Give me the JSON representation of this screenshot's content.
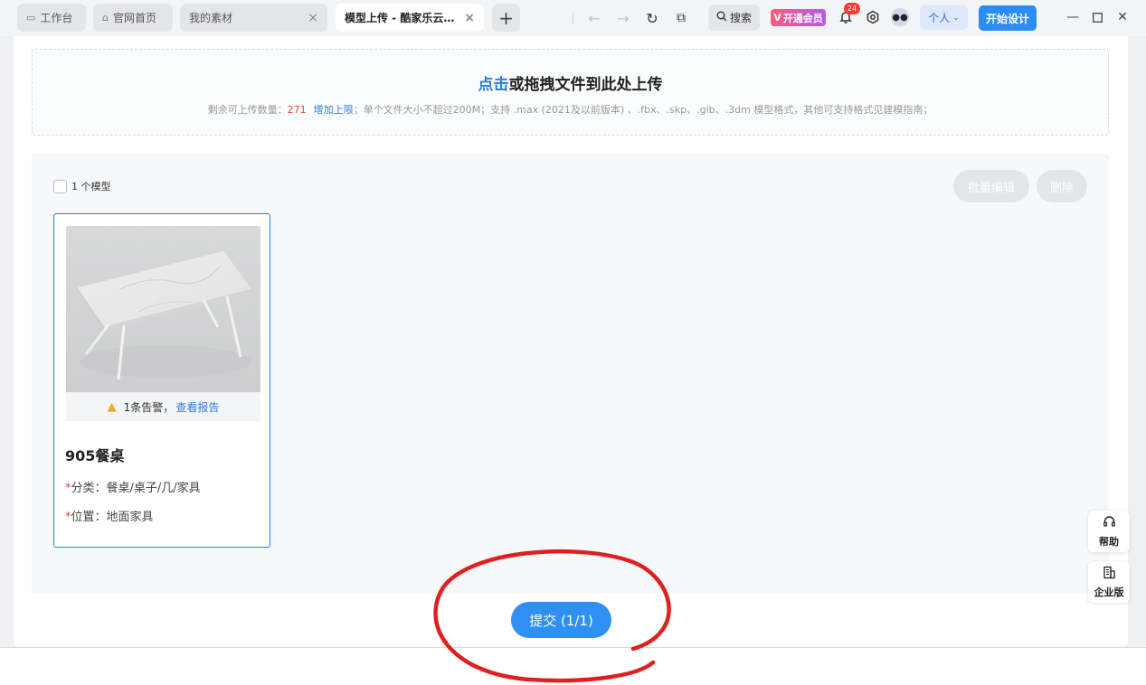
{
  "tabs": [
    {
      "label": "工作台",
      "icon": "monitor-icon"
    },
    {
      "label": "官网首页",
      "icon": "home-icon"
    },
    {
      "label": "我的素材"
    },
    {
      "label": "模型上传 - 酷家乐云..."
    }
  ],
  "toolbar": {
    "search_label": "搜索",
    "vip_label": "开通会员",
    "notification_count": "24",
    "personal_label": "个人",
    "start_design_label": "开始设计"
  },
  "upload": {
    "click_label": "点击",
    "title_rest": "或拖拽文件到此处上传",
    "remaining_label": "剩余可上传数量：",
    "remaining_count": "271",
    "increase_label": "增加上限",
    "desc": "；单个文件大小不超过200M；支持 .max (2021及以前版本) 、.fbx、.skp、.glb、.3dm 模型格式，其他可支持格式见建模指南；"
  },
  "list": {
    "select_all_label": "1 个模型",
    "batch_edit_label": "批量编辑",
    "delete_label": "删除"
  },
  "card": {
    "warning_text": "1条告警，",
    "view_report_label": "查看报告",
    "title": "905餐桌",
    "category_label": "分类：",
    "category_value": "餐桌/桌子/几/家具",
    "position_label": "位置：",
    "position_value": "地面家具"
  },
  "side": {
    "help_label": "帮助",
    "enterprise_label": "企业版"
  },
  "submit_label": "提交 (1/1)",
  "colors": {
    "primary": "#2f8ff3",
    "danger": "#e5453a",
    "annotation": "#e02020"
  }
}
